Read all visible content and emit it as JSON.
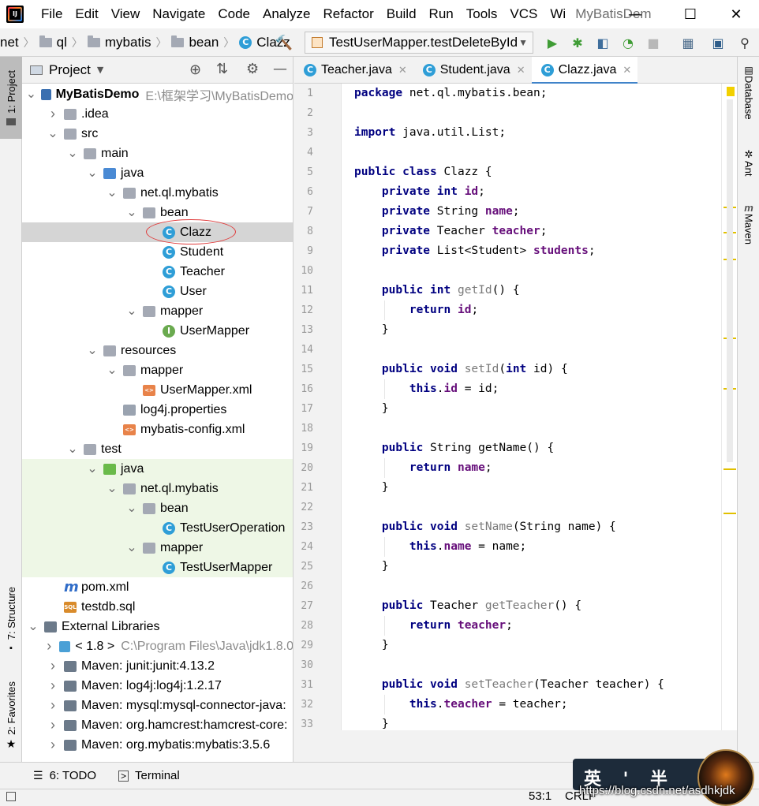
{
  "menubar": {
    "items": [
      {
        "label": "File"
      },
      {
        "label": "Edit"
      },
      {
        "label": "View"
      },
      {
        "label": "Navigate"
      },
      {
        "label": "Code"
      },
      {
        "label": "Analyze"
      },
      {
        "label": "Refactor"
      },
      {
        "label": "Build"
      },
      {
        "label": "Run"
      },
      {
        "label": "Tools"
      },
      {
        "label": "VCS"
      },
      {
        "label": "Wi"
      }
    ],
    "window_title": "MyBatisDem"
  },
  "navbar": {
    "crumbs": [
      "net",
      "ql",
      "mybatis",
      "bean",
      "Clazz"
    ],
    "run_config": "TestUserMapper.testDeleteById"
  },
  "left_stripe": {
    "project_tab": "1: Project",
    "structure_tab": "7: Structure",
    "favorites_tab": "2: Favorites"
  },
  "project_panel": {
    "title": "Project",
    "tree": [
      {
        "label": "MyBatisDemo",
        "extra": "E:\\框架学习\\MyBatisDemo",
        "arrow": "down",
        "icon": "module-icon",
        "bold": true
      },
      {
        "label": ".idea",
        "arrow": "right",
        "icon": "folder-icon"
      },
      {
        "label": "src",
        "arrow": "down",
        "icon": "folder-icon"
      },
      {
        "label": "main",
        "arrow": "down",
        "icon": "folder-icon"
      },
      {
        "label": "java",
        "arrow": "down",
        "icon": "source-folder-icon"
      },
      {
        "label": "net.ql.mybatis",
        "arrow": "down",
        "icon": "package-icon"
      },
      {
        "label": "bean",
        "arrow": "down",
        "icon": "package-icon"
      },
      {
        "label": "Clazz",
        "arrow": "",
        "icon": "class-icon",
        "selected": true
      },
      {
        "label": "Student",
        "arrow": "",
        "icon": "class-icon"
      },
      {
        "label": "Teacher",
        "arrow": "",
        "icon": "class-icon"
      },
      {
        "label": "User",
        "arrow": "",
        "icon": "class-icon"
      },
      {
        "label": "mapper",
        "arrow": "down",
        "icon": "package-icon"
      },
      {
        "label": "UserMapper",
        "arrow": "",
        "icon": "interface-icon"
      },
      {
        "label": "resources",
        "arrow": "down",
        "icon": "resources-folder-icon"
      },
      {
        "label": "mapper",
        "arrow": "down",
        "icon": "folder-icon"
      },
      {
        "label": "UserMapper.xml",
        "arrow": "",
        "icon": "xml-file-icon"
      },
      {
        "label": "log4j.properties",
        "arrow": "",
        "icon": "properties-file-icon"
      },
      {
        "label": "mybatis-config.xml",
        "arrow": "",
        "icon": "xml-file-icon"
      },
      {
        "label": "test",
        "arrow": "down",
        "icon": "folder-icon"
      },
      {
        "label": "java",
        "arrow": "down",
        "icon": "test-source-folder-icon",
        "test": true
      },
      {
        "label": "net.ql.mybatis",
        "arrow": "down",
        "icon": "package-icon",
        "test": true
      },
      {
        "label": "bean",
        "arrow": "down",
        "icon": "package-icon",
        "test": true
      },
      {
        "label": "TestUserOperation",
        "arrow": "",
        "icon": "test-class-icon",
        "test": true
      },
      {
        "label": "mapper",
        "arrow": "down",
        "icon": "package-icon",
        "test": true
      },
      {
        "label": "TestUserMapper",
        "arrow": "",
        "icon": "test-class-icon",
        "test": true
      },
      {
        "label": "pom.xml",
        "arrow": "",
        "icon": "maven-icon"
      },
      {
        "label": "testdb.sql",
        "arrow": "",
        "icon": "sql-file-icon"
      },
      {
        "label": "External Libraries",
        "arrow": "down",
        "icon": "libraries-icon"
      },
      {
        "label": "< 1.8 >",
        "extra": "C:\\Program Files\\Java\\jdk1.8.0",
        "arrow": "right",
        "icon": "jdk-icon"
      },
      {
        "label": "Maven: junit:junit:4.13.2",
        "arrow": "right",
        "icon": "library-icon"
      },
      {
        "label": "Maven: log4j:log4j:1.2.17",
        "arrow": "right",
        "icon": "library-icon"
      },
      {
        "label": "Maven: mysql:mysql-connector-java:",
        "arrow": "right",
        "icon": "library-icon"
      },
      {
        "label": "Maven: org.hamcrest:hamcrest-core:",
        "arrow": "right",
        "icon": "library-icon"
      },
      {
        "label": "Maven: org.mybatis:mybatis:3.5.6",
        "arrow": "right",
        "icon": "library-icon"
      }
    ]
  },
  "editor": {
    "tabs": [
      {
        "label": "Teacher.java",
        "active": false
      },
      {
        "label": "Student.java",
        "active": false
      },
      {
        "label": "Clazz.java",
        "active": true
      }
    ],
    "code": [
      "package net.ql.mybatis.bean;",
      "",
      "import java.util.List;",
      "",
      "public class Clazz {",
      "    private int id;",
      "    private String name;",
      "    private Teacher teacher;",
      "    private List<Student> students;",
      "",
      "    public int getId() {",
      "        return id;",
      "    }",
      "",
      "    public void setId(int id) {",
      "        this.id = id;",
      "    }",
      "",
      "    public String getName() {",
      "        return name;",
      "    }",
      "",
      "    public void setName(String name) {",
      "        this.name = name;",
      "    }",
      "",
      "    public Teacher getTeacher() {",
      "        return teacher;",
      "    }",
      "",
      "    public void setTeacher(Teacher teacher) {",
      "        this.teacher = teacher;",
      "    }"
    ]
  },
  "right_stripe": {
    "database_tab": "Database",
    "ant_tab": "Ant",
    "maven_tab": "Maven"
  },
  "bottom_bar": {
    "todo_tab": "6: TODO",
    "terminal_tab": "Terminal"
  },
  "status_bar": {
    "position": "53:1",
    "line_sep": "CRLF"
  },
  "watermark": {
    "chars": "英 ' 半 ",
    "url": "https://blog.csdn.net/asdhkjdk"
  },
  "colors": {
    "keyword": "#000080",
    "field": "#660e7a",
    "selection": "#d5d5d5",
    "test_bg": "#eef7e6",
    "accent": "#4083c9",
    "annotation": "#e03c3c"
  }
}
